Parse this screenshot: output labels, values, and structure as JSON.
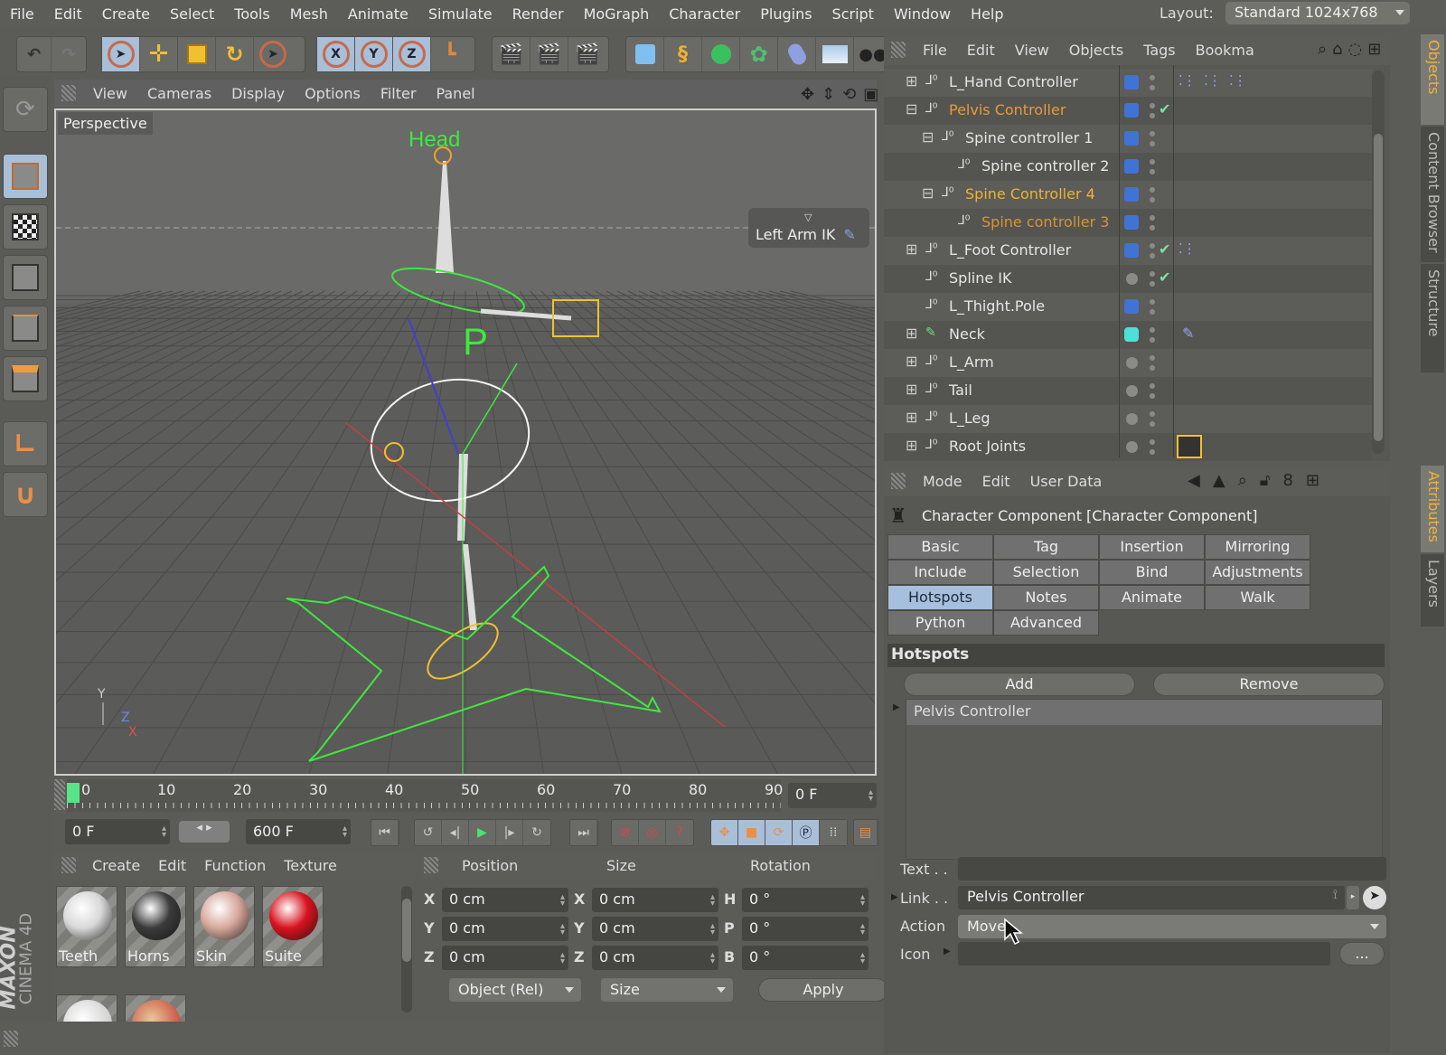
{
  "menubar": {
    "items": [
      "File",
      "Edit",
      "Create",
      "Select",
      "Tools",
      "Mesh",
      "Animate",
      "Simulate",
      "Render",
      "MoGraph",
      "Character",
      "Plugins",
      "Script",
      "Window",
      "Help"
    ],
    "layout_label": "Layout:",
    "layout_value": "Standard 1024x768"
  },
  "toolbar": {
    "axis_x": "X",
    "axis_y": "Y",
    "axis_z": "Z"
  },
  "viewport": {
    "menu": [
      "View",
      "Cameras",
      "Display",
      "Options",
      "Filter",
      "Panel"
    ],
    "camera_label": "Perspective",
    "hotspot_label": "Left Arm IK",
    "head_label": "Head",
    "p_label": "P",
    "axis_y": "Y",
    "axis_z": "Z",
    "axis_x": "X"
  },
  "timeline": {
    "ticks": [
      "0",
      "10",
      "20",
      "30",
      "40",
      "50",
      "60",
      "70",
      "80",
      "90"
    ],
    "current_frame": "0 F",
    "start_frame": "0 F",
    "end_frame": "600 F",
    "progress": 0
  },
  "materials": {
    "menu": [
      "Create",
      "Edit",
      "Function",
      "Texture"
    ],
    "items": [
      {
        "name": "Teeth",
        "color": "#d8d8d8"
      },
      {
        "name": "Horns",
        "color": "#3b3b3b"
      },
      {
        "name": "Skin",
        "color": "#d7a89c"
      },
      {
        "name": "Suite",
        "color": "#d9131f"
      }
    ]
  },
  "coordinates": {
    "headers": {
      "position": "Position",
      "size": "Size",
      "rotation": "Rotation"
    },
    "position": [
      {
        "axis": "X",
        "value": "0 cm"
      },
      {
        "axis": "Y",
        "value": "0 cm"
      },
      {
        "axis": "Z",
        "value": "0 cm"
      }
    ],
    "size": [
      {
        "axis": "X",
        "value": "0 cm"
      },
      {
        "axis": "Y",
        "value": "0 cm"
      },
      {
        "axis": "Z",
        "value": "0 cm"
      }
    ],
    "rotation": [
      {
        "axis": "H",
        "value": "0 °"
      },
      {
        "axis": "P",
        "value": "0 °"
      },
      {
        "axis": "B",
        "value": "0 °"
      }
    ],
    "mode_select": "Object (Rel)",
    "size_select": "Size",
    "apply_label": "Apply"
  },
  "logo": {
    "brand": "MAXON",
    "product": "CINEMA 4D"
  },
  "objects": {
    "menu": [
      "File",
      "Edit",
      "View",
      "Objects",
      "Tags",
      "Bookma"
    ],
    "rows": [
      {
        "name": "L_Hand Controller",
        "state": "normal",
        "layer": "blue",
        "check": false,
        "tags": "...:...:...:"
      },
      {
        "name": "Pelvis Controller",
        "state": "selected",
        "layer": "blue",
        "check": true,
        "tags": ""
      },
      {
        "name": "Spine controller 1",
        "state": "normal",
        "layer": "blue",
        "check": false,
        "tags": ""
      },
      {
        "name": "Spine controller 2",
        "state": "normal",
        "layer": "blue",
        "check": false,
        "tags": ""
      },
      {
        "name": "Spine Controller 4",
        "state": "active",
        "layer": "blue",
        "check": false,
        "tags": ""
      },
      {
        "name": "Spine controller 3",
        "state": "child-selected",
        "layer": "blue",
        "check": false,
        "tags": ""
      },
      {
        "name": "L_Foot Controller",
        "state": "normal",
        "layer": "blue",
        "check": true,
        "tags": "...:"
      },
      {
        "name": "Spline IK",
        "state": "normal",
        "layer": "grey",
        "check": true,
        "tags": ""
      },
      {
        "name": "L_Thight.Pole",
        "state": "normal",
        "layer": "blue",
        "check": false,
        "tags": ""
      },
      {
        "name": "Neck",
        "state": "normal",
        "layer": "cyan",
        "check": false,
        "tags": "pin"
      },
      {
        "name": "L_Arm",
        "state": "normal",
        "layer": "grey",
        "check": false,
        "tags": ""
      },
      {
        "name": "Tail",
        "state": "normal",
        "layer": "grey",
        "check": false,
        "tags": ""
      },
      {
        "name": "L_Leg",
        "state": "normal",
        "layer": "grey",
        "check": false,
        "tags": ""
      },
      {
        "name": "Root Joints",
        "state": "normal",
        "layer": "grey",
        "check": false,
        "tags": "character"
      }
    ]
  },
  "side_tabs_top": [
    "Objects",
    "Content Browser",
    "Structure"
  ],
  "side_tabs_bottom": [
    "Attributes",
    "Layers"
  ],
  "attributes": {
    "menu": [
      "Mode",
      "Edit",
      "User Data"
    ],
    "title": "Character Component [Character Component]",
    "tabs": [
      "Basic",
      "Tag",
      "Insertion",
      "Mirroring",
      "Include",
      "Selection",
      "Bind",
      "Adjustments",
      "Hotspots",
      "Notes",
      "Animate",
      "Walk",
      "Python",
      "Advanced"
    ],
    "active_tab": "Hotspots",
    "section": "Hotspots",
    "add_label": "Add",
    "remove_label": "Remove",
    "hotspot_items": [
      "Pelvis Controller"
    ],
    "text_label": "Text . .",
    "text_value": "",
    "link_label": "Link . .",
    "link_value": "Pelvis Controller",
    "action_label": "Action",
    "action_value": "Move",
    "icon_label": "Icon",
    "icon_value": "",
    "browse_label": "..."
  },
  "colors": {
    "accent_orange": "#e89a3a",
    "selection_blue": "#a6bfdc",
    "layer_blue": "#3f74d6",
    "rig_green": "#39e83a"
  }
}
